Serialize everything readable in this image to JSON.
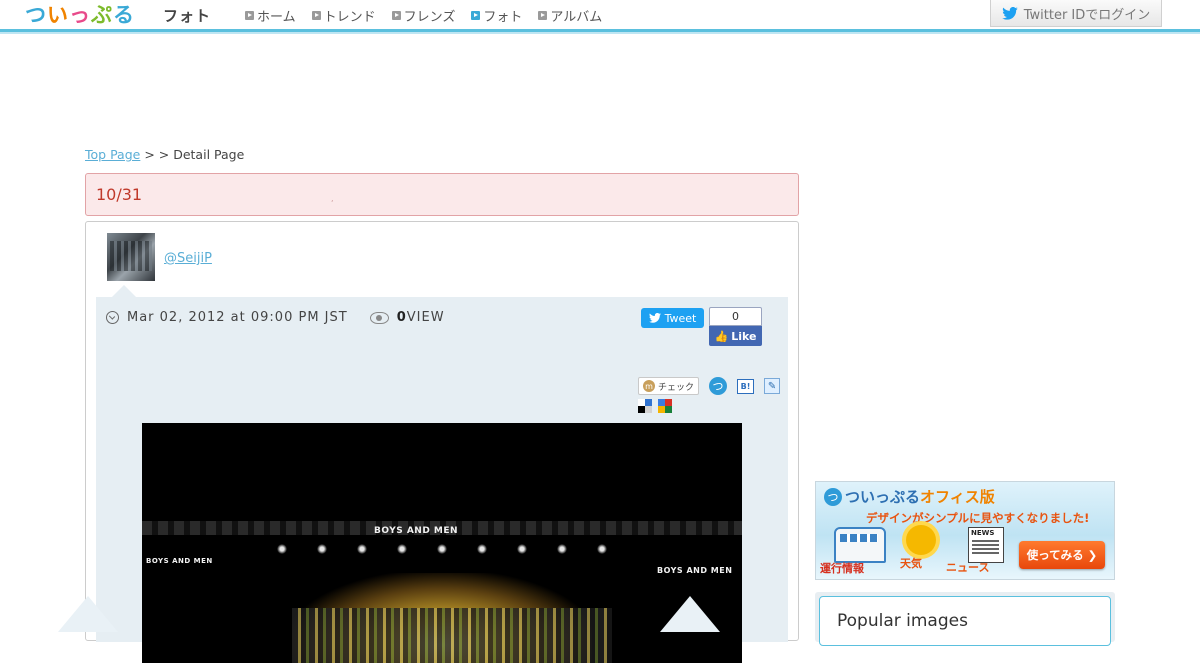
{
  "header": {
    "logo": {
      "chars": [
        "つ",
        "い",
        "っ",
        "ぷ",
        "る"
      ],
      "colors": [
        "#3aa9d6",
        "#f08300",
        "#e84a8a",
        "#7dbb2c",
        "#3aa9d6"
      ]
    },
    "section_title": "フォト",
    "nav": [
      {
        "label": "ホーム",
        "active": false
      },
      {
        "label": "トレンド",
        "active": false
      },
      {
        "label": "フレンズ",
        "active": false
      },
      {
        "label": "フォト",
        "active": true
      },
      {
        "label": "アルバム",
        "active": false
      }
    ],
    "login_label": "Twitter IDでログイン",
    "accent_color": "#5bc0de"
  },
  "breadcrumb": {
    "home": "Top Page",
    "sep1": " > ",
    "sep2": " > ",
    "current": "Detail Page"
  },
  "post": {
    "title": "10/31",
    "title_tiny": ",",
    "username": "@SeijiP",
    "date": "Mar 02, 2012 at 09:00 PM JST",
    "view_count": "0",
    "view_label": "VIEW",
    "tweet_label": "Tweet",
    "like_count": "0",
    "like_label": "Like",
    "mixi_label": "チェック",
    "mixi_icon": "m",
    "tsui_icon": "つ",
    "hatena_label": "B!",
    "pencil_icon": "✎",
    "photo_banners": [
      "BOYS AND MEN",
      "BOYS AND MEN",
      "BOYS AND MEN"
    ]
  },
  "sidebar": {
    "office_banner": {
      "logo_icon": "つ",
      "name_main": "ついっぷる",
      "name_accent": "オフィス版",
      "subtitle": "デザインがシンプルに見やすくなりました!",
      "label_train": "運行情報",
      "label_weather": "天気",
      "label_news": "ニュース",
      "button": "使ってみる"
    },
    "popular_title": "Popular images"
  }
}
